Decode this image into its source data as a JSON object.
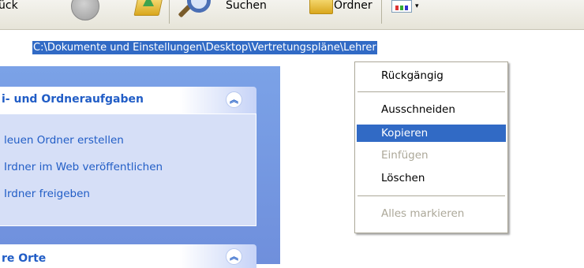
{
  "toolbar": {
    "back_label": "ück",
    "search_label": "Suchen",
    "folders_label": "Ordner"
  },
  "address": {
    "path": "C:\\Dokumente und Einstellungen\\Desktop\\Vertretungspläne\\Lehrer"
  },
  "task_pane": {
    "box1_title": "i- und Ordneraufgaben",
    "tasks": [
      "leuen Ordner erstellen",
      "Irdner im Web veröffentlichen",
      "Irdner freigeben"
    ],
    "box2_title": "re Orte"
  },
  "context_menu": {
    "items": {
      "undo": "Rückgängig",
      "cut": "Ausschneiden",
      "copy": "Kopieren",
      "paste": "Einfügen",
      "delete": "Löschen",
      "select_all": "Alles markieren"
    }
  },
  "colors": {
    "selection": "#316ac5",
    "task_link": "#215dc6",
    "pane_bg": "#7ba2e7",
    "disabled_text": "#aca899"
  }
}
